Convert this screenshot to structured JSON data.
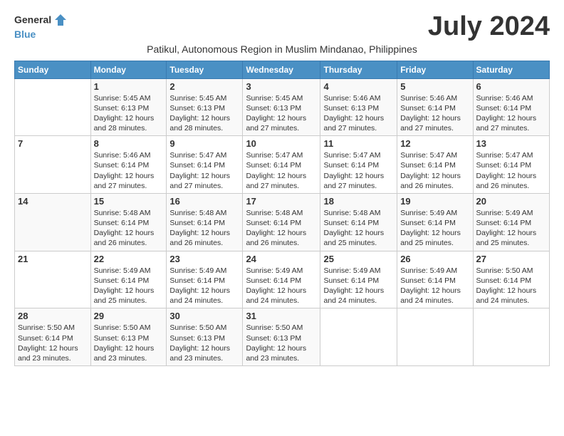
{
  "header": {
    "logo_line1": "General",
    "logo_line2": "Blue",
    "month_title": "July 2024",
    "subtitle": "Patikul, Autonomous Region in Muslim Mindanao, Philippines"
  },
  "weekdays": [
    "Sunday",
    "Monday",
    "Tuesday",
    "Wednesday",
    "Thursday",
    "Friday",
    "Saturday"
  ],
  "weeks": [
    [
      {
        "day": "",
        "info": ""
      },
      {
        "day": "1",
        "info": "Sunrise: 5:45 AM\nSunset: 6:13 PM\nDaylight: 12 hours\nand 28 minutes."
      },
      {
        "day": "2",
        "info": "Sunrise: 5:45 AM\nSunset: 6:13 PM\nDaylight: 12 hours\nand 28 minutes."
      },
      {
        "day": "3",
        "info": "Sunrise: 5:45 AM\nSunset: 6:13 PM\nDaylight: 12 hours\nand 27 minutes."
      },
      {
        "day": "4",
        "info": "Sunrise: 5:46 AM\nSunset: 6:13 PM\nDaylight: 12 hours\nand 27 minutes."
      },
      {
        "day": "5",
        "info": "Sunrise: 5:46 AM\nSunset: 6:14 PM\nDaylight: 12 hours\nand 27 minutes."
      },
      {
        "day": "6",
        "info": "Sunrise: 5:46 AM\nSunset: 6:14 PM\nDaylight: 12 hours\nand 27 minutes."
      }
    ],
    [
      {
        "day": "7",
        "info": ""
      },
      {
        "day": "8",
        "info": "Sunrise: 5:46 AM\nSunset: 6:14 PM\nDaylight: 12 hours\nand 27 minutes."
      },
      {
        "day": "9",
        "info": "Sunrise: 5:47 AM\nSunset: 6:14 PM\nDaylight: 12 hours\nand 27 minutes."
      },
      {
        "day": "10",
        "info": "Sunrise: 5:47 AM\nSunset: 6:14 PM\nDaylight: 12 hours\nand 27 minutes."
      },
      {
        "day": "11",
        "info": "Sunrise: 5:47 AM\nSunset: 6:14 PM\nDaylight: 12 hours\nand 27 minutes."
      },
      {
        "day": "12",
        "info": "Sunrise: 5:47 AM\nSunset: 6:14 PM\nDaylight: 12 hours\nand 26 minutes."
      },
      {
        "day": "13",
        "info": "Sunrise: 5:47 AM\nSunset: 6:14 PM\nDaylight: 12 hours\nand 26 minutes."
      }
    ],
    [
      {
        "day": "14",
        "info": ""
      },
      {
        "day": "15",
        "info": "Sunrise: 5:48 AM\nSunset: 6:14 PM\nDaylight: 12 hours\nand 26 minutes."
      },
      {
        "day": "16",
        "info": "Sunrise: 5:48 AM\nSunset: 6:14 PM\nDaylight: 12 hours\nand 26 minutes."
      },
      {
        "day": "17",
        "info": "Sunrise: 5:48 AM\nSunset: 6:14 PM\nDaylight: 12 hours\nand 26 minutes."
      },
      {
        "day": "18",
        "info": "Sunrise: 5:48 AM\nSunset: 6:14 PM\nDaylight: 12 hours\nand 25 minutes."
      },
      {
        "day": "19",
        "info": "Sunrise: 5:49 AM\nSunset: 6:14 PM\nDaylight: 12 hours\nand 25 minutes."
      },
      {
        "day": "20",
        "info": "Sunrise: 5:49 AM\nSunset: 6:14 PM\nDaylight: 12 hours\nand 25 minutes."
      }
    ],
    [
      {
        "day": "21",
        "info": ""
      },
      {
        "day": "22",
        "info": "Sunrise: 5:49 AM\nSunset: 6:14 PM\nDaylight: 12 hours\nand 25 minutes."
      },
      {
        "day": "23",
        "info": "Sunrise: 5:49 AM\nSunset: 6:14 PM\nDaylight: 12 hours\nand 24 minutes."
      },
      {
        "day": "24",
        "info": "Sunrise: 5:49 AM\nSunset: 6:14 PM\nDaylight: 12 hours\nand 24 minutes."
      },
      {
        "day": "25",
        "info": "Sunrise: 5:49 AM\nSunset: 6:14 PM\nDaylight: 12 hours\nand 24 minutes."
      },
      {
        "day": "26",
        "info": "Sunrise: 5:49 AM\nSunset: 6:14 PM\nDaylight: 12 hours\nand 24 minutes."
      },
      {
        "day": "27",
        "info": "Sunrise: 5:50 AM\nSunset: 6:14 PM\nDaylight: 12 hours\nand 24 minutes."
      }
    ],
    [
      {
        "day": "28",
        "info": "Sunrise: 5:50 AM\nSunset: 6:14 PM\nDaylight: 12 hours\nand 23 minutes."
      },
      {
        "day": "29",
        "info": "Sunrise: 5:50 AM\nSunset: 6:13 PM\nDaylight: 12 hours\nand 23 minutes."
      },
      {
        "day": "30",
        "info": "Sunrise: 5:50 AM\nSunset: 6:13 PM\nDaylight: 12 hours\nand 23 minutes."
      },
      {
        "day": "31",
        "info": "Sunrise: 5:50 AM\nSunset: 6:13 PM\nDaylight: 12 hours\nand 23 minutes."
      },
      {
        "day": "",
        "info": ""
      },
      {
        "day": "",
        "info": ""
      },
      {
        "day": "",
        "info": ""
      }
    ]
  ]
}
